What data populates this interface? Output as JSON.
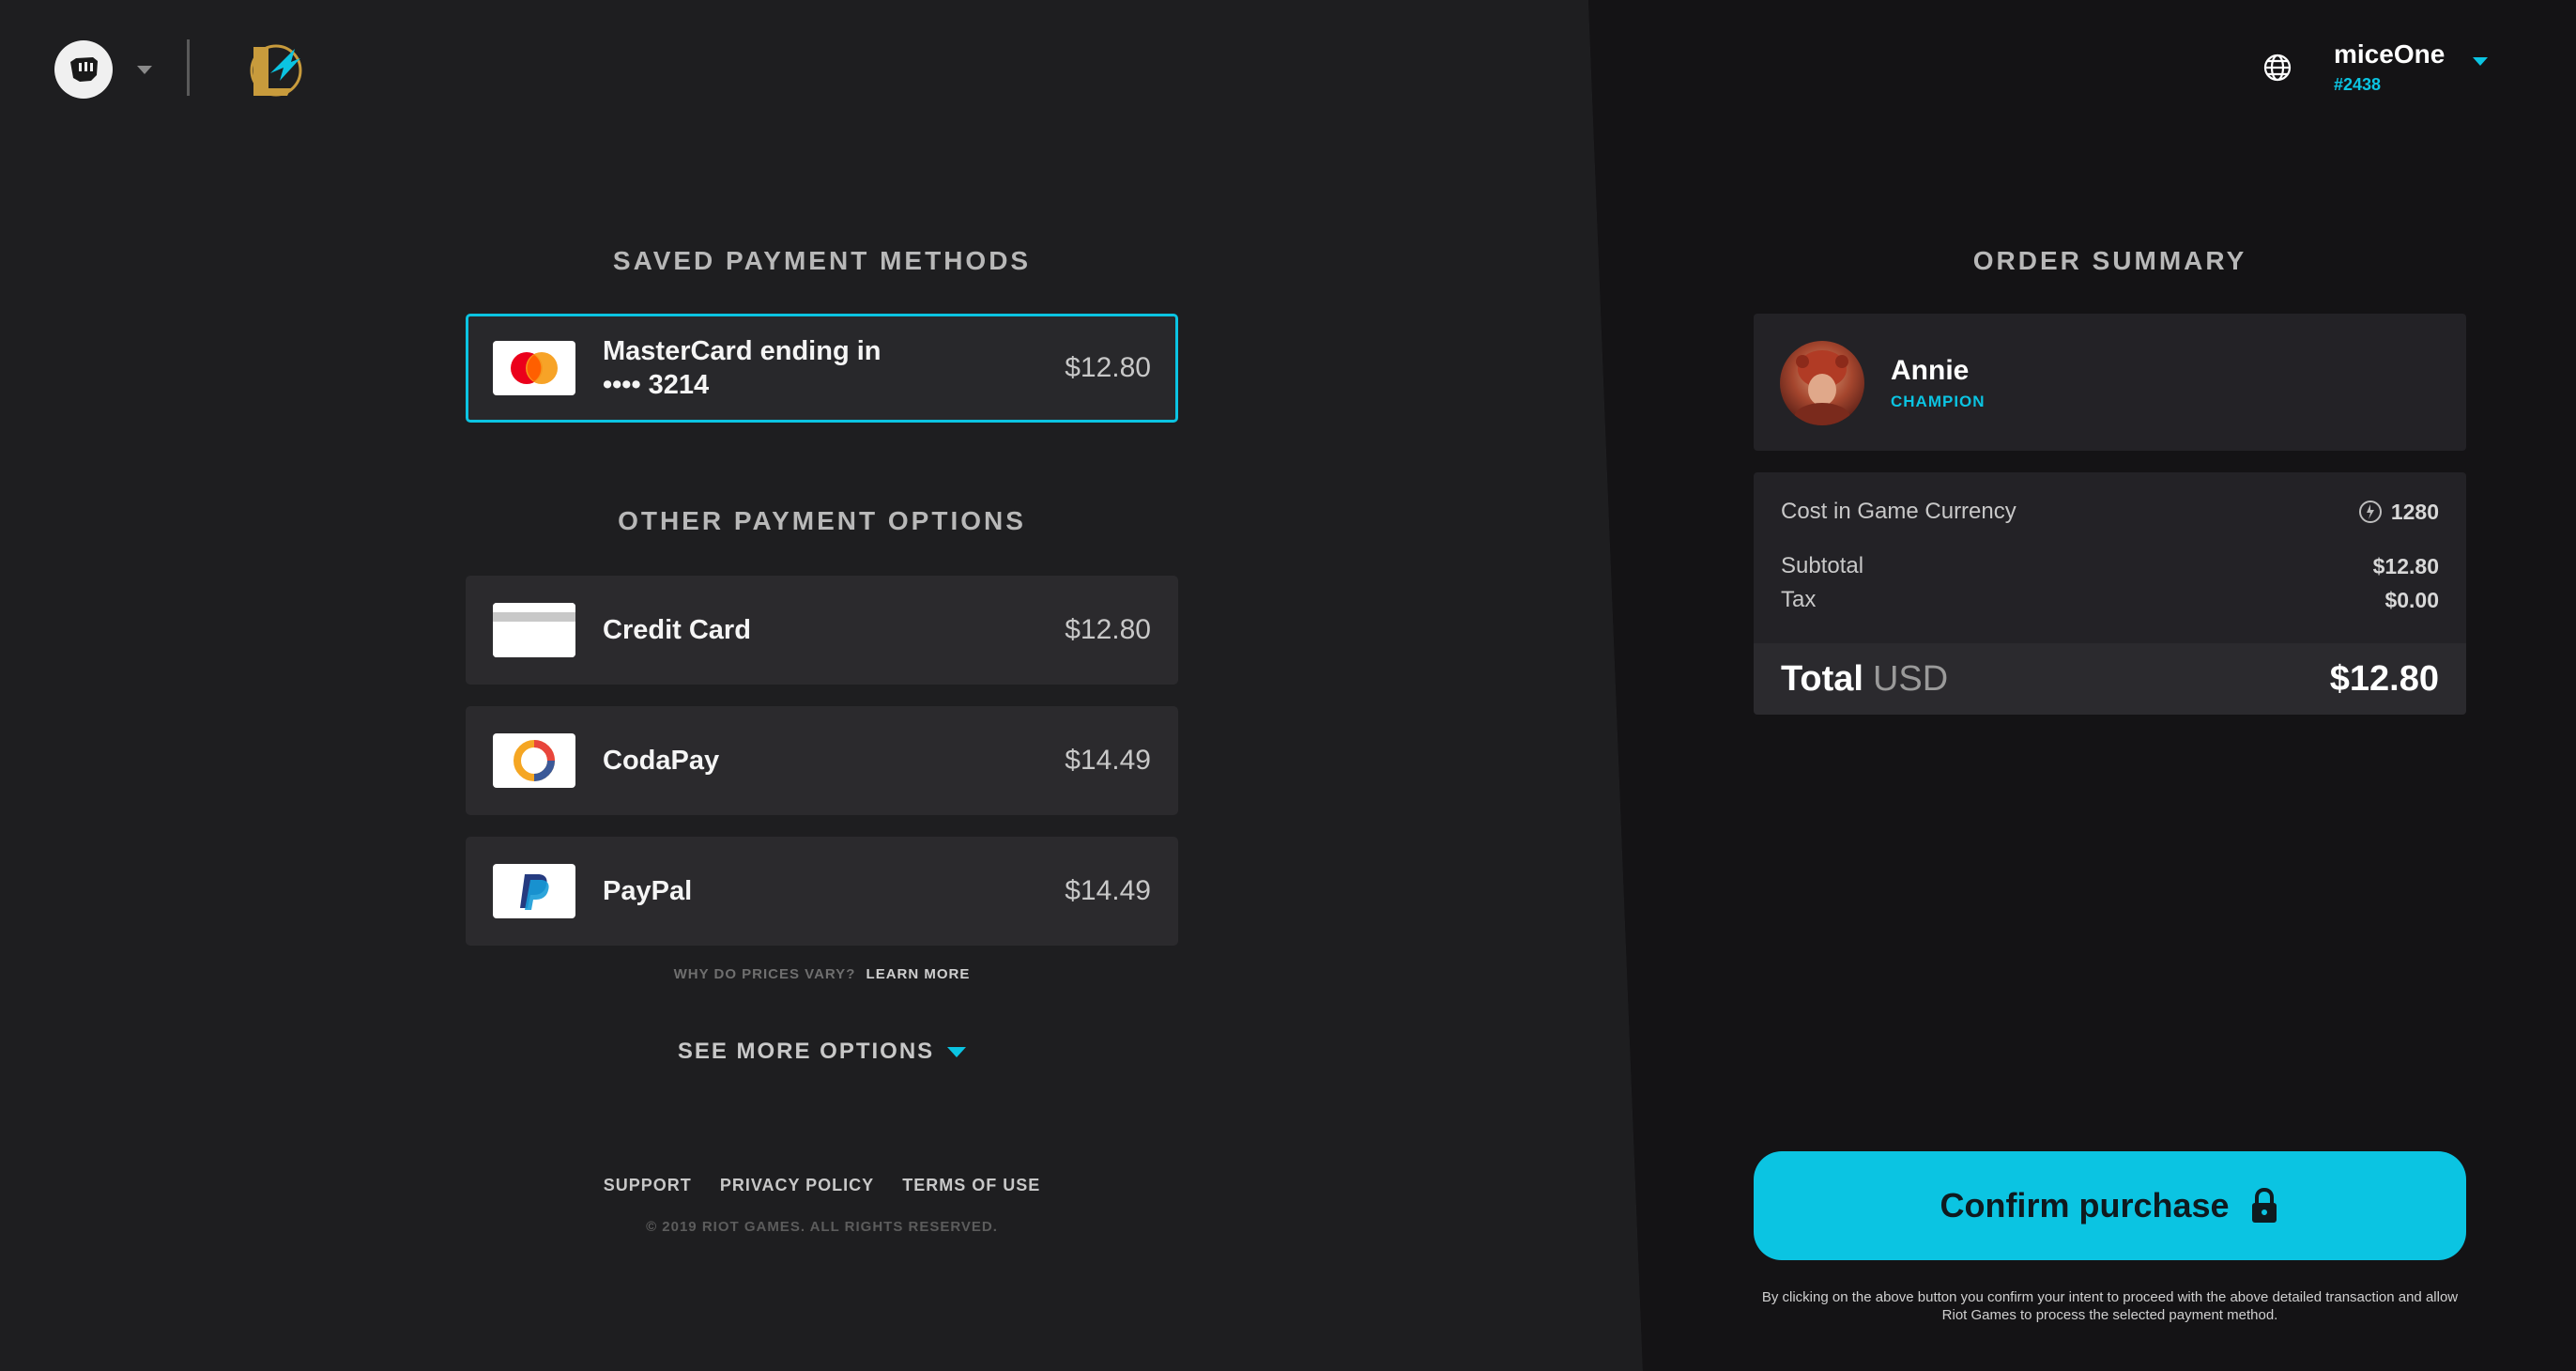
{
  "header": {
    "riot_logo": "riot-fist-icon",
    "game_logo": "league-of-legends-icon",
    "user": {
      "name": "miceOne",
      "tag": "#2438"
    }
  },
  "saved_methods": {
    "title": "SAVED PAYMENT METHODS",
    "items": [
      {
        "label_line1": "MasterCard ending in",
        "label_line2": "•••• 3214",
        "price": "$12.80",
        "icon": "mastercard-icon",
        "selected": true
      }
    ]
  },
  "other_methods": {
    "title": "OTHER PAYMENT OPTIONS",
    "items": [
      {
        "label": "Credit Card",
        "price": "$12.80",
        "icon": "credit-card-icon"
      },
      {
        "label": "CodaPay",
        "price": "$14.49",
        "icon": "codapay-icon"
      },
      {
        "label": "PayPal",
        "price": "$14.49",
        "icon": "paypal-icon"
      }
    ]
  },
  "prices_vary": {
    "question": "WHY DO PRICES VARY?",
    "link": "LEARN MORE"
  },
  "see_more": "SEE MORE OPTIONS",
  "footer": {
    "links": [
      "SUPPORT",
      "PRIVACY POLICY",
      "TERMS OF USE"
    ],
    "copyright": "© 2019 RIOT GAMES. ALL RIGHTS RESERVED."
  },
  "order_summary": {
    "title": "ORDER SUMMARY",
    "item": {
      "name": "Annie",
      "type": "CHAMPION"
    },
    "cost_in_game_label": "Cost in Game Currency",
    "cost_in_game_value": "1280",
    "subtotal_label": "Subtotal",
    "subtotal_value": "$12.80",
    "tax_label": "Tax",
    "tax_value": "$0.00",
    "total_label": "Total",
    "total_currency": "USD",
    "total_value": "$12.80"
  },
  "confirm": {
    "label": "Confirm purchase",
    "disclaimer": "By clicking on the above button you confirm your intent to proceed with the above detailed transaction and allow Riot Games to process the selected payment method."
  },
  "colors": {
    "accent": "#0bc4e2",
    "left_panel": "#1e1e20",
    "right_panel": "#141315"
  }
}
